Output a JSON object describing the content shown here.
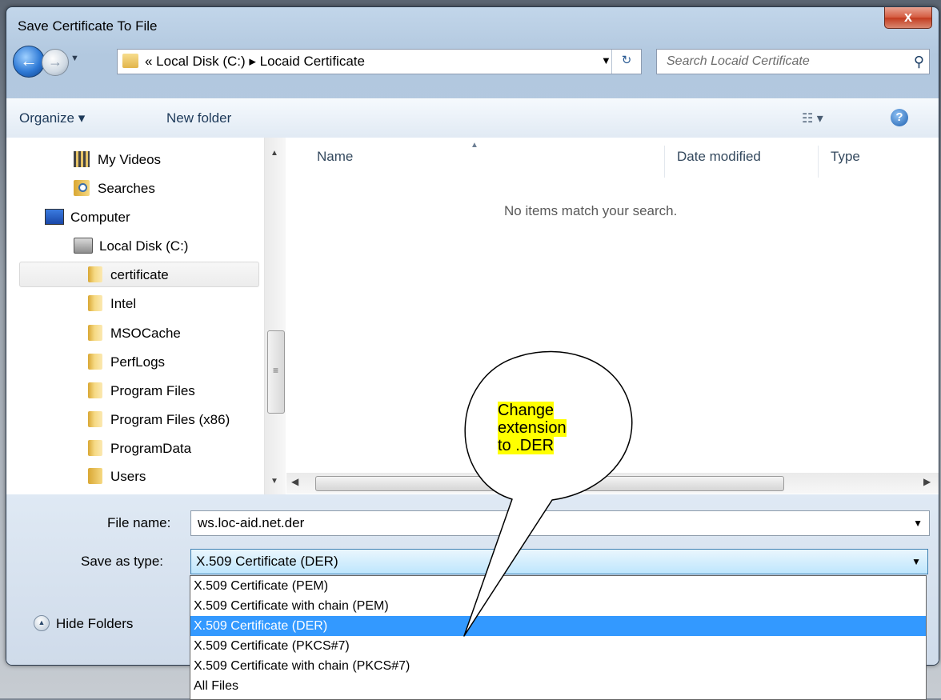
{
  "window": {
    "title": "Save Certificate To File",
    "close_glyph": "x"
  },
  "nav": {
    "back_glyph": "←",
    "address": "«  Local Disk (C:)  ▸  Locaid Certificate",
    "search_placeholder": "Search Locaid Certificate"
  },
  "toolbar": {
    "organize": "Organize ▾",
    "new_folder": "New folder",
    "help": "?"
  },
  "tree": {
    "items": [
      {
        "label": "My Videos",
        "icon": "video-folder-icon"
      },
      {
        "label": "Searches",
        "icon": "searches-folder-icon"
      },
      {
        "label": "Computer",
        "icon": "computer-icon"
      },
      {
        "label": "Local Disk (C:)",
        "icon": "disk-icon"
      },
      {
        "label": "certificate",
        "icon": "folder-icon",
        "selected": true
      },
      {
        "label": "Intel",
        "icon": "folder-icon"
      },
      {
        "label": "MSOCache",
        "icon": "folder-icon"
      },
      {
        "label": "PerfLogs",
        "icon": "folder-icon"
      },
      {
        "label": "Program Files",
        "icon": "folder-icon"
      },
      {
        "label": "Program Files (x86)",
        "icon": "folder-icon"
      },
      {
        "label": "ProgramData",
        "icon": "folder-icon"
      },
      {
        "label": "Users",
        "icon": "folder-icon"
      }
    ]
  },
  "files": {
    "columns": [
      "Name",
      "Date modified",
      "Type"
    ],
    "empty_message": "No items match your search."
  },
  "form": {
    "file_name_label": "File name:",
    "file_name_value": "ws.loc-aid.net.der",
    "save_type_label": "Save as type:",
    "save_type_value": "X.509 Certificate (DER)",
    "hide_folders": "Hide Folders"
  },
  "type_options": [
    "X.509 Certificate (PEM)",
    "X.509 Certificate with chain (PEM)",
    "X.509 Certificate (DER)",
    "X.509 Certificate (PKCS#7)",
    "X.509 Certificate with chain (PKCS#7)",
    "All Files"
  ],
  "selected_type_index": 2,
  "callout": {
    "line1": "Change",
    "line2": "extension",
    "line3": "to .DER"
  },
  "colors": {
    "callout_highlight": "#ffff00",
    "selection": "#3399ff",
    "close_button": "#c23b1f"
  }
}
